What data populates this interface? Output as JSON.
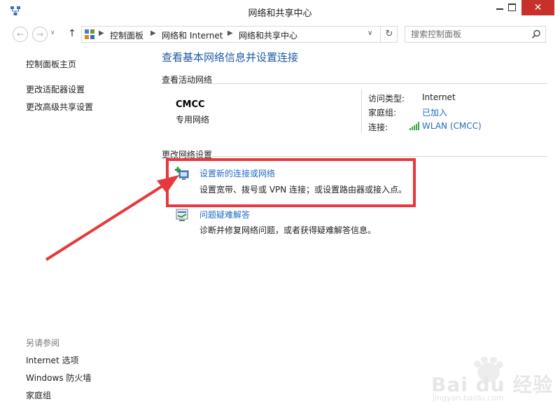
{
  "window": {
    "title": "网络和共享中心",
    "close_glyph": "✕"
  },
  "navbar": {
    "back_glyph": "←",
    "forward_glyph": "→",
    "up_glyph": "↑",
    "breadcrumbs": [
      "控制面板",
      "网络和 Internet",
      "网络和共享中心"
    ],
    "separator_glyph": "▶",
    "dropdown_glyph": "∨",
    "refresh_glyph": "↻",
    "search_placeholder": "搜索控制面板"
  },
  "sidebar": {
    "home_link": "控制面板主页",
    "links": [
      "更改适配器设置",
      "更改高级共享设置"
    ],
    "see_also_label": "另请参阅",
    "see_also_links": [
      "Internet 选项",
      "Windows 防火墙",
      "家庭组"
    ]
  },
  "main": {
    "heading": "查看基本网络信息并设置连接",
    "active_networks_label": "查看活动网络",
    "network": {
      "name": "CMCC",
      "type": "专用网络",
      "access_type_label": "访问类型:",
      "access_type_value": "Internet",
      "homegroup_label": "家庭组:",
      "homegroup_value": "已加入",
      "connections_label": "连接:",
      "connections_value": "WLAN (CMCC)"
    },
    "change_settings_label": "更改网络设置",
    "tasks": [
      {
        "title": "设置新的连接或网络",
        "description": "设置宽带、拨号或 VPN 连接；或设置路由器或接入点。"
      },
      {
        "title": "问题疑难解答",
        "description": "诊断并修复网络问题，或者获得疑难解答信息。"
      }
    ]
  },
  "watermark": {
    "brand": "Bai du 经验",
    "url": "jingyan.baidu.com"
  },
  "colors": {
    "link": "#1f6bc3",
    "heading": "#1d5aa6",
    "close": "#c7302b",
    "annotation": "#e8383d"
  }
}
